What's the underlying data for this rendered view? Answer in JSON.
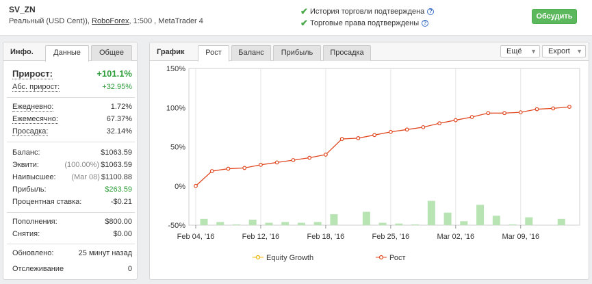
{
  "header": {
    "account_name": "SV_ZN",
    "account_type": "Реальный (USD Cent)),",
    "broker": "RoboForex",
    "account_rest": ", 1:500 , MetaTrader 4",
    "verify_history": "История торговли подтверждена",
    "verify_rights": "Торговые права подтверждены",
    "discuss_label": "Обсудить"
  },
  "left_panel": {
    "title": "Инфо.",
    "tabs": [
      "Данные",
      "Общее"
    ],
    "active_tab": "Данные",
    "gain": {
      "label": "Прирост:",
      "value": "+101.1%"
    },
    "abs_gain": {
      "label": "Абс. прирост:",
      "value": "+32.95%"
    },
    "daily": {
      "label": "Ежедневно:",
      "value": "1.72%"
    },
    "monthly": {
      "label": "Ежемесячно:",
      "value": "67.37%"
    },
    "drawdown": {
      "label": "Просадка:",
      "value": "32.14%"
    },
    "balance": {
      "label": "Баланс:",
      "value": "$1063.59"
    },
    "equity": {
      "label": "Эквити:",
      "note": "(100.00%)",
      "value": "$1063.59"
    },
    "highest": {
      "label": "Наивысшее:",
      "note": "(Mar 08)",
      "value": "$1100.88"
    },
    "profit": {
      "label": "Прибыль:",
      "value": "$263.59"
    },
    "interest": {
      "label": "Процентная ставка:",
      "value": "-$0.21"
    },
    "deposits": {
      "label": "Пополнения:",
      "value": "$800.00"
    },
    "withdrawals": {
      "label": "Снятия:",
      "value": "$0.00"
    },
    "updated": {
      "label": "Обновлено:",
      "value": "25 минут назад"
    },
    "tracking": {
      "label": "Отслеживание",
      "value": "0"
    }
  },
  "chart_panel": {
    "title": "График",
    "tabs": [
      "Рост",
      "Баланс",
      "Прибыль",
      "Просадка"
    ],
    "active_tab": "Рост",
    "more_label": "Ещё",
    "export_label": "Export"
  },
  "chart_data": {
    "type": "line",
    "y_ticks": [
      "150%",
      "100%",
      "50%",
      "0%",
      "-50%"
    ],
    "ylim": [
      -50,
      150
    ],
    "x_ticks": [
      "Feb 04, '16",
      "Feb 12, '16",
      "Feb 18, '16",
      "Feb 25, '16",
      "Mar 02, '16",
      "Mar 09, '16"
    ],
    "x_tick_index": [
      0,
      4,
      8,
      12,
      16,
      20
    ],
    "n_points": 24,
    "grid": "vertical",
    "legend_position": "bottom",
    "series": [
      {
        "name": "Equity Growth",
        "color": "#f0b400",
        "values": []
      },
      {
        "name": "Рост",
        "color": "#e0461e",
        "values": [
          0,
          19,
          22,
          23,
          27,
          30,
          33,
          36,
          40,
          60,
          61,
          65,
          69,
          72,
          75,
          80,
          84,
          88,
          93,
          93,
          94,
          98,
          99,
          101
        ]
      }
    ],
    "bars": {
      "color": "#b8e4b4",
      "values": [
        -42,
        -46,
        -49,
        -43,
        -47,
        -46,
        -47,
        -46,
        -36,
        -50,
        -33,
        -47,
        -48,
        -49,
        -19,
        -34,
        -45,
        -24,
        -38,
        -49,
        -40,
        -50,
        -42,
        -50
      ]
    }
  }
}
